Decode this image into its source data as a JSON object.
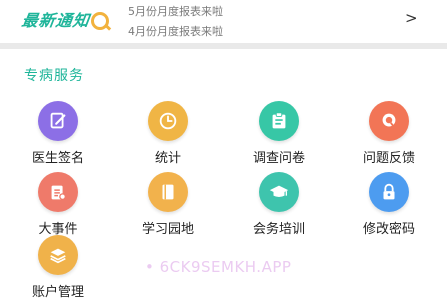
{
  "notice": {
    "logo_text": "最新通知",
    "lines": [
      "5月份月度报表来啦",
      "4月份月度报表来啦"
    ],
    "arrow": ">"
  },
  "section": {
    "title": "专病服务"
  },
  "services": [
    {
      "label": "医生签名",
      "icon": "edit-icon",
      "color": "#8c6fe6"
    },
    {
      "label": "统计",
      "icon": "clock-icon",
      "color": "#f0b545"
    },
    {
      "label": "调查问卷",
      "icon": "clipboard-icon",
      "color": "#37c7a6"
    },
    {
      "label": "问题反馈",
      "icon": "search-icon",
      "color": "#f27556"
    },
    {
      "label": "大事件",
      "icon": "calendar-icon",
      "color": "#ef7a6a"
    },
    {
      "label": "学习园地",
      "icon": "book-icon",
      "color": "#f2b24c"
    },
    {
      "label": "会务培训",
      "icon": "graduation-cap-icon",
      "color": "#3ec4ad"
    },
    {
      "label": "修改密码",
      "icon": "lock-icon",
      "color": "#4d9cf0"
    },
    {
      "label": "账户管理",
      "icon": "layers-icon",
      "color": "#f0b24a"
    }
  ],
  "watermark": "• 6CK9SEMKH.APP"
}
